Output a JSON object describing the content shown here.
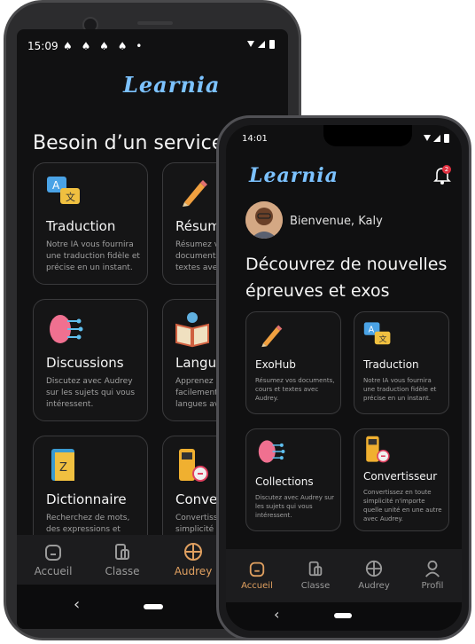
{
  "back_phone": {
    "status": {
      "time": "15:09",
      "notif_icons": "♠ ♠ ♠ ♠ •"
    },
    "logo": "Learnia",
    "headline": "Besoin d’un service?",
    "cards": [
      {
        "title": "Traduction",
        "desc": "Notre IA vous fournira une traduction fidèle et précise en un instant.",
        "icon": "translate-icon"
      },
      {
        "title": "Résumé",
        "desc": "Résumez vos documents, cours et textes avec",
        "icon": "pencil-icon"
      },
      {
        "title": "Discussions",
        "desc": "Discutez avec Audrey sur les sujets qui vous intéressent.",
        "icon": "brain-icon"
      },
      {
        "title": "Langues",
        "desc": "Apprenez plus facilement de nouvelles langues avec",
        "icon": "book-icon"
      },
      {
        "title": "Dictionnaire",
        "desc": "Recherchez de mots, des expressions et",
        "icon": "dictionary-icon"
      },
      {
        "title": "Convertisseur",
        "desc": "Convertissez en toute simplicité n'importe",
        "icon": "converter-icon"
      }
    ],
    "nav": [
      {
        "label": "Accueil",
        "icon": "home-icon"
      },
      {
        "label": "Classe",
        "icon": "class-icon"
      },
      {
        "label": "Audrey",
        "icon": "audrey-icon"
      }
    ],
    "back_glyph": "‹"
  },
  "front_phone": {
    "status": {
      "time": "14:01"
    },
    "logo": "Learnia",
    "notification_badge": "2",
    "greeting": "Bienvenue, Kaly",
    "headline_line1": "Découvrez de nouvelles",
    "headline_line2": "épreuves et exos",
    "cards": [
      {
        "title": "ExoHub",
        "desc": "Résumez vos documents, cours et textes avec Audrey.",
        "icon": "pencil-icon"
      },
      {
        "title": "Traduction",
        "desc": "Notre IA vous fournira une traduction fidèle et précise en un instant.",
        "icon": "translate-icon"
      },
      {
        "title": "Collections",
        "desc": "Discutez avec Audrey sur les sujets qui vous intéressent.",
        "icon": "brain-icon"
      },
      {
        "title": "Convertisseur",
        "desc": "Convertissez en toute simplicité n'importe quelle unité en une autre avec Audrey.",
        "icon": "converter-icon"
      }
    ],
    "nav": [
      {
        "label": "Accueil",
        "icon": "home-icon"
      },
      {
        "label": "Classe",
        "icon": "class-icon"
      },
      {
        "label": "Audrey",
        "icon": "audrey-icon"
      },
      {
        "label": "Profil",
        "icon": "profile-icon"
      }
    ],
    "back_glyph": "‹"
  },
  "colors": {
    "accent": "#e0a060",
    "logo": "#7cc2ff",
    "background": "#111112"
  }
}
